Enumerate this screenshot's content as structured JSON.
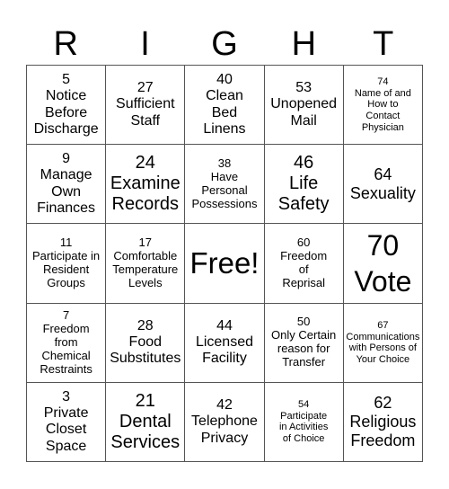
{
  "header": {
    "letters": [
      "R",
      "I",
      "G",
      "H",
      "T"
    ]
  },
  "board": {
    "rows": [
      [
        {
          "text": "5\nNotice\nBefore\nDischarge",
          "size": "md"
        },
        {
          "text": "27\nSufficient\nStaff",
          "size": "md"
        },
        {
          "text": "40\nClean\nBed\nLinens",
          "size": "md"
        },
        {
          "text": "53\nUnopened\nMail",
          "size": "md"
        },
        {
          "text": "74\nName of and\nHow to\nContact\nPhysician",
          "size": "xs"
        }
      ],
      [
        {
          "text": "9\nManage\nOwn\nFinances",
          "size": "md"
        },
        {
          "text": "24\nExamine\nRecords",
          "size": "lg"
        },
        {
          "text": "38\nHave\nPersonal\nPossessions",
          "size": "sm"
        },
        {
          "text": "46\nLife\nSafety",
          "size": "lg"
        },
        {
          "text": "64\nSexuality",
          "size": "lg-ish"
        }
      ],
      [
        {
          "text": "11\nParticipate in\nResident\nGroups",
          "size": "sm"
        },
        {
          "text": "17\nComfortable\nTemperature\nLevels",
          "size": "sm"
        },
        {
          "text": "Free!",
          "size": "free"
        },
        {
          "text": "60\nFreedom\nof\nReprisal",
          "size": "sm"
        },
        {
          "text": "70\nVote",
          "size": "xl"
        }
      ],
      [
        {
          "text": "7\nFreedom\nfrom\nChemical\nRestraints",
          "size": "sm"
        },
        {
          "text": "28\nFood\nSubstitutes",
          "size": "md"
        },
        {
          "text": "44\nLicensed\nFacility",
          "size": "md"
        },
        {
          "text": "50\nOnly Certain\nreason for\nTransfer",
          "size": "sm"
        },
        {
          "text": "67\nCommunications\nwith Persons of\nYour Choice",
          "size": "xs"
        }
      ],
      [
        {
          "text": "3\nPrivate\nCloset\nSpace",
          "size": "md"
        },
        {
          "text": "21\nDental\nServices",
          "size": "lg"
        },
        {
          "text": "42\nTelephone\nPrivacy",
          "size": "md"
        },
        {
          "text": "54\nParticipate\nin Activities\nof Choice",
          "size": "xs"
        },
        {
          "text": "62\nReligious\nFreedom",
          "size": "lg-ish"
        }
      ]
    ]
  }
}
